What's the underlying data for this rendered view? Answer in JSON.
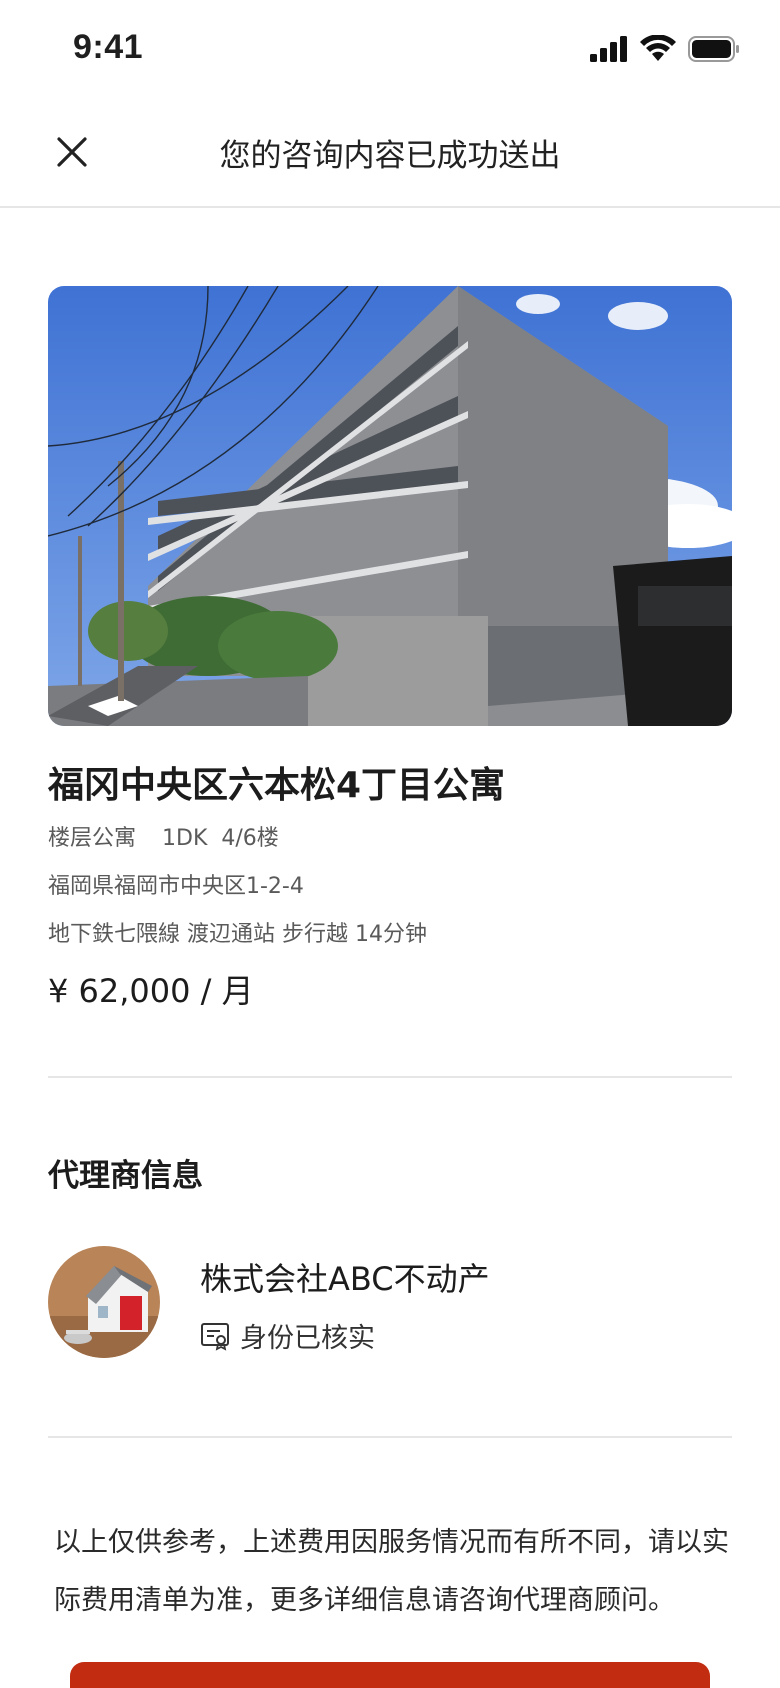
{
  "status_bar": {
    "time": "9:41"
  },
  "nav": {
    "title": "您的咨询内容已成功送出",
    "close_icon": "close-icon"
  },
  "property": {
    "title": "福冈中央区六本松4丁目公寓",
    "type": "楼层公寓",
    "layout": "1DK",
    "floor": "4/6楼",
    "address": "福岡県福岡市中央区1-2-4",
    "station": "地下鉄七隈線 渡辺通站 步行越 14分钟",
    "price": "¥ 62,000 / 月"
  },
  "agent_section": {
    "title": "代理商信息",
    "agent_name": "株式会社ABC不动产",
    "verified_label": "身份已核实",
    "verified_icon": "id-card-icon"
  },
  "disclaimer": "以上仅供参考，上述费用因服务情况而有所不同，请以实际费用清单为准，更多详细信息请咨询代理商顾问。",
  "colors": {
    "accent": "#c22d12",
    "divider": "#e6e6e6",
    "sky": "#4f7fd6"
  }
}
